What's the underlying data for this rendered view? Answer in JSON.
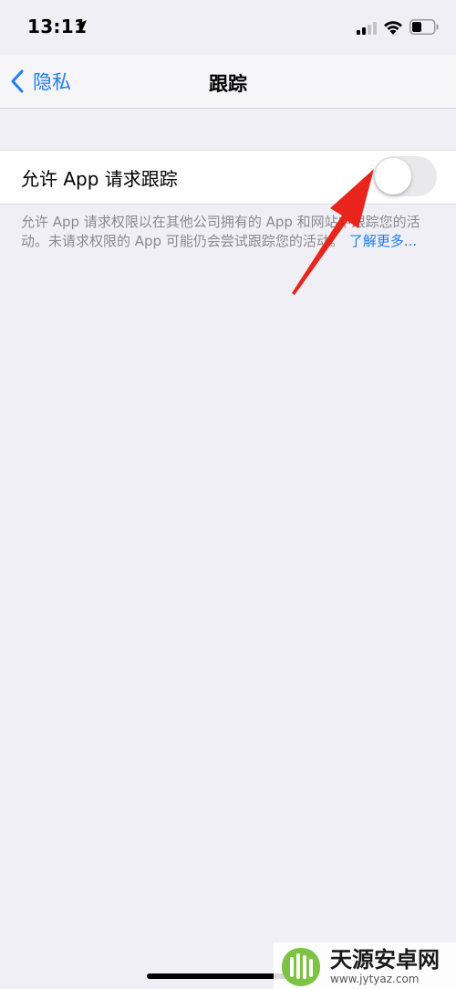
{
  "status_bar": {
    "time": "13:11"
  },
  "nav": {
    "back_label": "隐私",
    "title": "跟踪"
  },
  "setting": {
    "label": "允许 App 请求跟踪",
    "toggle_on": false
  },
  "footer": {
    "description": "允许 App 请求权限以在其他公司拥有的 App 和网站中跟踪您的活动。未请求权限的 App 可能仍会尝试跟踪您的活动。",
    "learn_more": "了解更多..."
  },
  "watermark": {
    "title": "天源安卓网",
    "url": "www.jytyaz.com"
  },
  "colors": {
    "accent": "#1f7ef5",
    "background": "#f0eff5",
    "toggle_off": "#e9e9eb",
    "arrow": "#e8241c"
  }
}
